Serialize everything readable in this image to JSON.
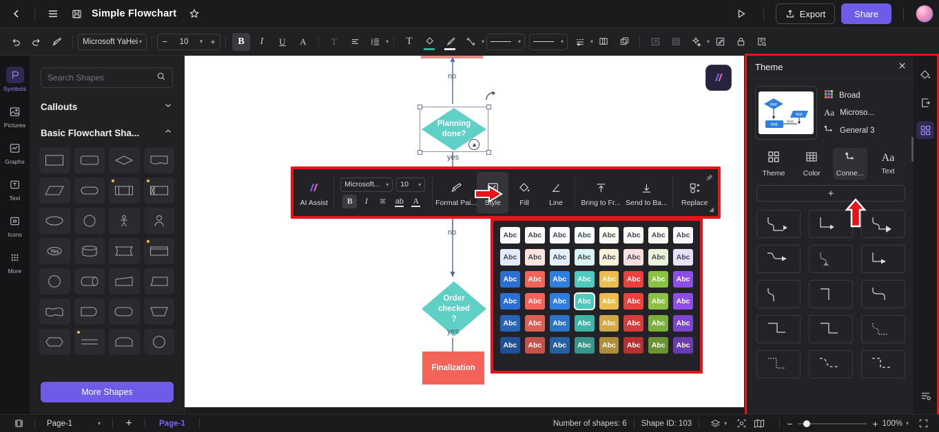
{
  "titlebar": {
    "back_icon": "chevron-left-icon",
    "menu_icon": "hamburger-menu-icon",
    "save_icon": "save-disk-icon",
    "title": "Simple Flowchart",
    "favorite_icon": "star-icon",
    "present_icon": "play-icon",
    "export_label": "Export",
    "share_label": "Share"
  },
  "ribbon": {
    "undo_icon": "undo-icon",
    "redo_icon": "redo-icon",
    "format_painter_icon": "format-painter-icon",
    "font_family": "Microsoft YaHei",
    "font_size": "10",
    "decrease_label": "−",
    "increase_label": "+",
    "bold_label": "B",
    "italic_label": "I",
    "underline_label": "U",
    "font_color_label": "A",
    "items": [
      "text-vertical-icon",
      "align-icon",
      "line-spacing-icon",
      "text-box-icon",
      "fill-icon",
      "brush-icon",
      "connector-icon",
      "line-style-icon",
      "line-weight-icon",
      "line-dash-icon",
      "group-icon",
      "duplicate-icon",
      "layers-icon",
      "crop-icon",
      "magic-icon",
      "edit-icon",
      "lock-icon",
      "inspect-icon"
    ]
  },
  "rail": {
    "items": [
      {
        "label": "Symbols",
        "icon": "symbols-icon",
        "active": true
      },
      {
        "label": "Pictures",
        "icon": "picture-icon",
        "active": false
      },
      {
        "label": "Graphs",
        "icon": "graph-icon",
        "active": false
      },
      {
        "label": "Text",
        "icon": "text-icon",
        "active": false
      },
      {
        "label": "Icons",
        "icon": "icons-icon",
        "active": false
      },
      {
        "label": "More",
        "icon": "more-grid-icon",
        "active": false
      }
    ]
  },
  "library": {
    "search_placeholder": "Search Shapes",
    "search_value": "",
    "search_icon": "search-icon",
    "sections": [
      {
        "title": "Callouts",
        "expanded": false,
        "chevron": "chevron-down-icon"
      },
      {
        "title": "Basic Flowchart Sha...",
        "expanded": true,
        "chevron": "chevron-up-icon"
      }
    ],
    "shapes": [
      {
        "name": "process",
        "badge": false
      },
      {
        "name": "rounded-rectangle",
        "badge": false
      },
      {
        "name": "decision-diamond",
        "badge": false
      },
      {
        "name": "document",
        "badge": false
      },
      {
        "name": "data-parallelogram",
        "badge": false
      },
      {
        "name": "terminator",
        "badge": false
      },
      {
        "name": "predefined-process",
        "badge": true
      },
      {
        "name": "internal-storage",
        "badge": true
      },
      {
        "name": "ellipse",
        "badge": false
      },
      {
        "name": "circle",
        "badge": false
      },
      {
        "name": "actor",
        "badge": false
      },
      {
        "name": "user",
        "badge": false
      },
      {
        "name": "decision-yes",
        "badge": false,
        "text": "Yes"
      },
      {
        "name": "database-cylinder",
        "badge": false
      },
      {
        "name": "tape-data",
        "badge": false
      },
      {
        "name": "card",
        "badge": true
      },
      {
        "name": "circle-outline",
        "badge": false
      },
      {
        "name": "direct-access-storage",
        "badge": false
      },
      {
        "name": "manual-input",
        "badge": false
      },
      {
        "name": "stored-data",
        "badge": false
      },
      {
        "name": "multi-document",
        "badge": false
      },
      {
        "name": "delay",
        "badge": false
      },
      {
        "name": "display",
        "badge": false
      },
      {
        "name": "manual-operation",
        "badge": false
      },
      {
        "name": "preparation-hexagon",
        "badge": false
      },
      {
        "name": "collate",
        "badge": true
      },
      {
        "name": "extract",
        "badge": false
      },
      {
        "name": "connector-circle",
        "badge": false
      }
    ],
    "more_shapes_label": "More Shapes"
  },
  "canvas": {
    "badge_icon": "app-logo-icon",
    "nodes": [
      {
        "name": "planning-done-decision",
        "type": "diamond",
        "text": [
          "Planning",
          "done?"
        ],
        "color": "#5fd0c5",
        "selected": true
      },
      {
        "name": "order-checked-decision",
        "type": "diamond",
        "text": [
          "Order",
          "checked",
          "?"
        ],
        "color": "#5fd0c5",
        "selected": false
      },
      {
        "name": "finalization-process",
        "type": "rect",
        "text": "Finalization",
        "color": "#f4635a",
        "selected": false
      }
    ],
    "edge_labels": [
      "no",
      "yes",
      "no",
      "yes"
    ],
    "edge_color": "#4a6a9a"
  },
  "float_toolbar": {
    "ai_assist_label": "AI Assist",
    "ai_assist_icon": "ai-sparkle-icon",
    "font_family": "Microsoft...",
    "font_size": "10",
    "bold_label": "B",
    "italic_label": "I",
    "align_icon": "align-icon",
    "case_label": "ab",
    "font_color_label": "A",
    "items": [
      {
        "label": "Format Pai...",
        "icon": "format-painter-icon",
        "selected": false
      },
      {
        "label": "Style",
        "icon": "style-icon",
        "selected": true
      },
      {
        "label": "Fill",
        "icon": "fill-bucket-icon",
        "selected": false
      },
      {
        "label": "Line",
        "icon": "line-pen-icon",
        "selected": false
      },
      {
        "label": "Bring to Fr...",
        "icon": "bring-to-front-icon",
        "selected": false
      },
      {
        "label": "Send to Ba...",
        "icon": "send-to-back-icon",
        "selected": false
      },
      {
        "label": "Replace",
        "icon": "replace-shape-icon",
        "selected": false
      }
    ],
    "pin_icon": "pin-icon",
    "pointer_icon": "red-arrow-right-icon"
  },
  "style_popup": {
    "swatch_text": "Abc",
    "selected_index": 27,
    "rows": [
      {
        "bg": [
          "#fdfdfd",
          "#fffaf9",
          "#fbfdff",
          "#f7fffd",
          "#fffdf4",
          "#fffbfa",
          "#fdfff6",
          "#fdfbff"
        ],
        "fg": [
          "#3e4756",
          "#3e4756",
          "#3e4756",
          "#3e4756",
          "#3e4756",
          "#3e4756",
          "#3e4756",
          "#3e4756"
        ]
      },
      {
        "bg": [
          "#e2ebf7",
          "#fde3df",
          "#e3eefb",
          "#dcf4f1",
          "#fbf0d8",
          "#fbdfe0",
          "#e9f3da",
          "#e7e1fa"
        ],
        "fg": [
          "#3e4756",
          "#3e4756",
          "#3e4756",
          "#3e4756",
          "#3e4756",
          "#3e4756",
          "#3e4756",
          "#3e4756"
        ]
      },
      {
        "bg": [
          "#2b6fd4",
          "#f4635a",
          "#2f7fe0",
          "#4ecbbd",
          "#ecbc4e",
          "#ee3f3f",
          "#8cc241",
          "#8b4ee8"
        ],
        "fg": [
          "#ffffff",
          "#ffffff",
          "#ffffff",
          "#ffffff",
          "#ffffff",
          "#ffffff",
          "#ffffff",
          "#ffffff"
        ]
      },
      {
        "bg": [
          "#2b6fd4",
          "#f4635a",
          "#2f7fe0",
          "#4ecbbd",
          "#ecbc4e",
          "#ee3f3f",
          "#8cc241",
          "#8b4ee8"
        ],
        "fg": [
          "#ffffff",
          "#ffffff",
          "#ffffff",
          "#ffffff",
          "#ffffff",
          "#ffffff",
          "#ffffff",
          "#ffffff"
        ]
      },
      {
        "bg": [
          "#2663b9",
          "#dc6054",
          "#2c74c7",
          "#3fb5a8",
          "#d0a944",
          "#d93a3a",
          "#7db03a",
          "#7c45cd"
        ],
        "fg": [
          "#ffffff",
          "#ffffff",
          "#ffffff",
          "#ffffff",
          "#ffffff",
          "#ffffff",
          "#ffffff",
          "#ffffff"
        ]
      },
      {
        "bg": [
          "#1f4f96",
          "#c2534a",
          "#245f9f",
          "#37968c",
          "#ae8e3b",
          "#b53030",
          "#6a9331",
          "#6a3bae"
        ],
        "fg": [
          "#ffffff",
          "#ffffff",
          "#ffffff",
          "#ffffff",
          "#ffffff",
          "#ffffff",
          "#ffffff",
          "#ffffff"
        ]
      }
    ]
  },
  "theme_panel": {
    "title": "Theme",
    "close_icon": "close-icon",
    "preview_name": "theme-preview",
    "preview_labels": [
      "text",
      "text",
      "text",
      "text"
    ],
    "meta": [
      {
        "label": "Broad",
        "icon": "color-grid-icon"
      },
      {
        "label": "Microso...",
        "icon": "font-aa-icon"
      },
      {
        "label": "General 3",
        "icon": "connector-icon"
      }
    ],
    "tabs": [
      {
        "label": "Theme",
        "icon": "theme-grid-icon",
        "selected": false
      },
      {
        "label": "Color",
        "icon": "color-table-icon",
        "selected": false
      },
      {
        "label": "Conne...",
        "icon": "connector-icon",
        "selected": true
      },
      {
        "label": "Text",
        "icon": "font-aa-icon",
        "selected": false
      }
    ],
    "add_label": "+",
    "connectors": [
      "curve-arrow-1",
      "elbow-arrow-2",
      "curve-arrow-3",
      "curve-arrow-4",
      "curve-arrow-dim-5",
      "elbow-arrow-6",
      "curve-plain-7",
      "elbow-plain-8",
      "curve-plain-9",
      "elbow-plain-10",
      "elbow-plain-11",
      "dotted-curve-12",
      "dotted-elbow-13",
      "dashed-curve-14",
      "dashed-elbow-15"
    ],
    "up_arrow_icon": "red-arrow-up-icon"
  },
  "right_rail": {
    "items": [
      {
        "name": "fill-color-icon",
        "active": false
      },
      {
        "name": "page-setup-icon",
        "active": false
      },
      {
        "name": "theme-grid-icon",
        "active": true
      }
    ],
    "bottom": {
      "name": "panel-settings-icon",
      "active": false
    }
  },
  "status": {
    "panel_toggle_icon": "panel-toggle-icon",
    "page_name": "Page-1",
    "add_page_label": "+",
    "page_tab": "Page-1",
    "shapes_count": "Number of shapes: 6",
    "shape_id": "Shape ID: 103",
    "layers_icon": "layers-icon",
    "focus_icon": "focus-icon",
    "map_icon": "minimap-icon",
    "zoom_out_label": "−",
    "zoom_in_label": "+",
    "zoom_level": "100%",
    "fullscreen_icon": "fullscreen-icon"
  }
}
